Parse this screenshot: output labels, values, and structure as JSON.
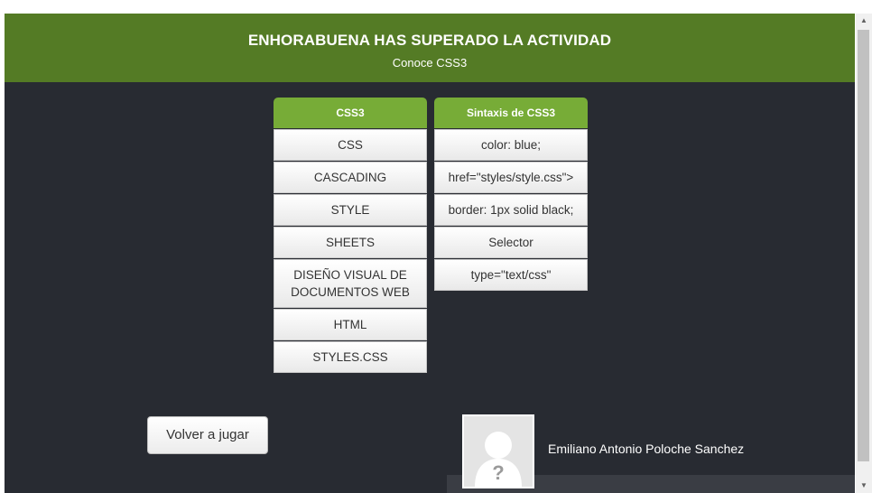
{
  "header": {
    "title": "ENHORABUENA HAS SUPERADO LA ACTIVIDAD",
    "subtitle": "Conoce CSS3"
  },
  "columns": [
    {
      "title": "CSS3",
      "items": [
        "CSS",
        "CASCADING",
        "STYLE",
        "SHEETS",
        "DISEÑO VISUAL DE DOCUMENTOS WEB",
        "HTML",
        "STYLES.CSS"
      ]
    },
    {
      "title": "Sintaxis de CSS3",
      "items": [
        "color: blue;",
        "href=\"styles/style.css\">",
        "border: 1px solid black;",
        "Selector",
        "type=\"text/css\""
      ]
    }
  ],
  "replay_label": "Volver a jugar",
  "user": {
    "name": "Emiliano Antonio Poloche Sanchez",
    "avatar_icon": "unknown-user-icon"
  },
  "colors": {
    "header_bg": "#547b25",
    "column_header_bg": "#77ac37",
    "page_bg": "#282b32"
  }
}
